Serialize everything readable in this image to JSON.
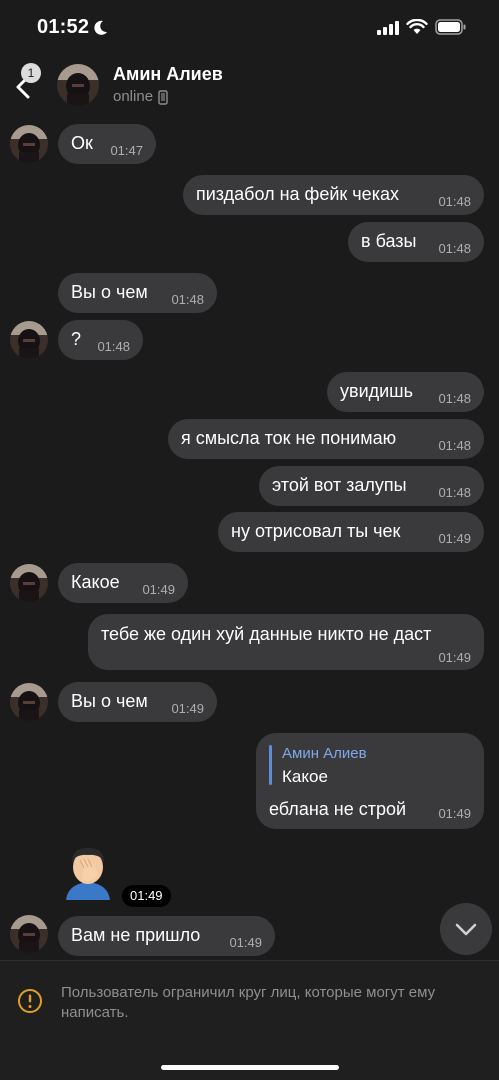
{
  "status_bar": {
    "time": "01:52"
  },
  "header": {
    "back_badge": "1",
    "name": "Амин Алиев",
    "status": "online"
  },
  "messages": [
    {
      "text": "Ок",
      "time": "01:47"
    },
    {
      "text": "пиздабол на фейк чеках",
      "time": "01:48"
    },
    {
      "text": "в базы",
      "time": "01:48"
    },
    {
      "text": "Вы о чем",
      "time": "01:48"
    },
    {
      "text": "?",
      "time": "01:48"
    },
    {
      "text": "увидишь",
      "time": "01:48"
    },
    {
      "text": "я смысла ток не понимаю",
      "time": "01:48"
    },
    {
      "text": "этой вот залупы",
      "time": "01:48"
    },
    {
      "text": "ну отрисовал ты чек",
      "time": "01:49"
    },
    {
      "text": "Какое",
      "time": "01:49"
    },
    {
      "text": "тебе же один хуй данные никто не даст",
      "time": "01:49"
    },
    {
      "text": "Вы о чем",
      "time": "01:49"
    },
    {
      "reply_name": "Амин Алиев",
      "reply_text": "Какое",
      "text": "еблана не строй",
      "time": "01:49"
    },
    {
      "emoji": "facepalm",
      "time": "01:49"
    },
    {
      "text": "Вам не пришло",
      "time": "01:49"
    }
  ],
  "footer": {
    "notice": "Пользователь ограничил круг лиц, которые могут ему написать."
  },
  "icons": [
    "moon-icon",
    "signal-icon",
    "wifi-icon",
    "battery-icon",
    "back-icon",
    "phone-icon",
    "chevron-down-icon",
    "info-icon"
  ],
  "colors": {
    "background": "#1b1b1b",
    "bubble": "#3a3a3c",
    "accent": "#7ea9e8",
    "warning": "#e0a020"
  }
}
